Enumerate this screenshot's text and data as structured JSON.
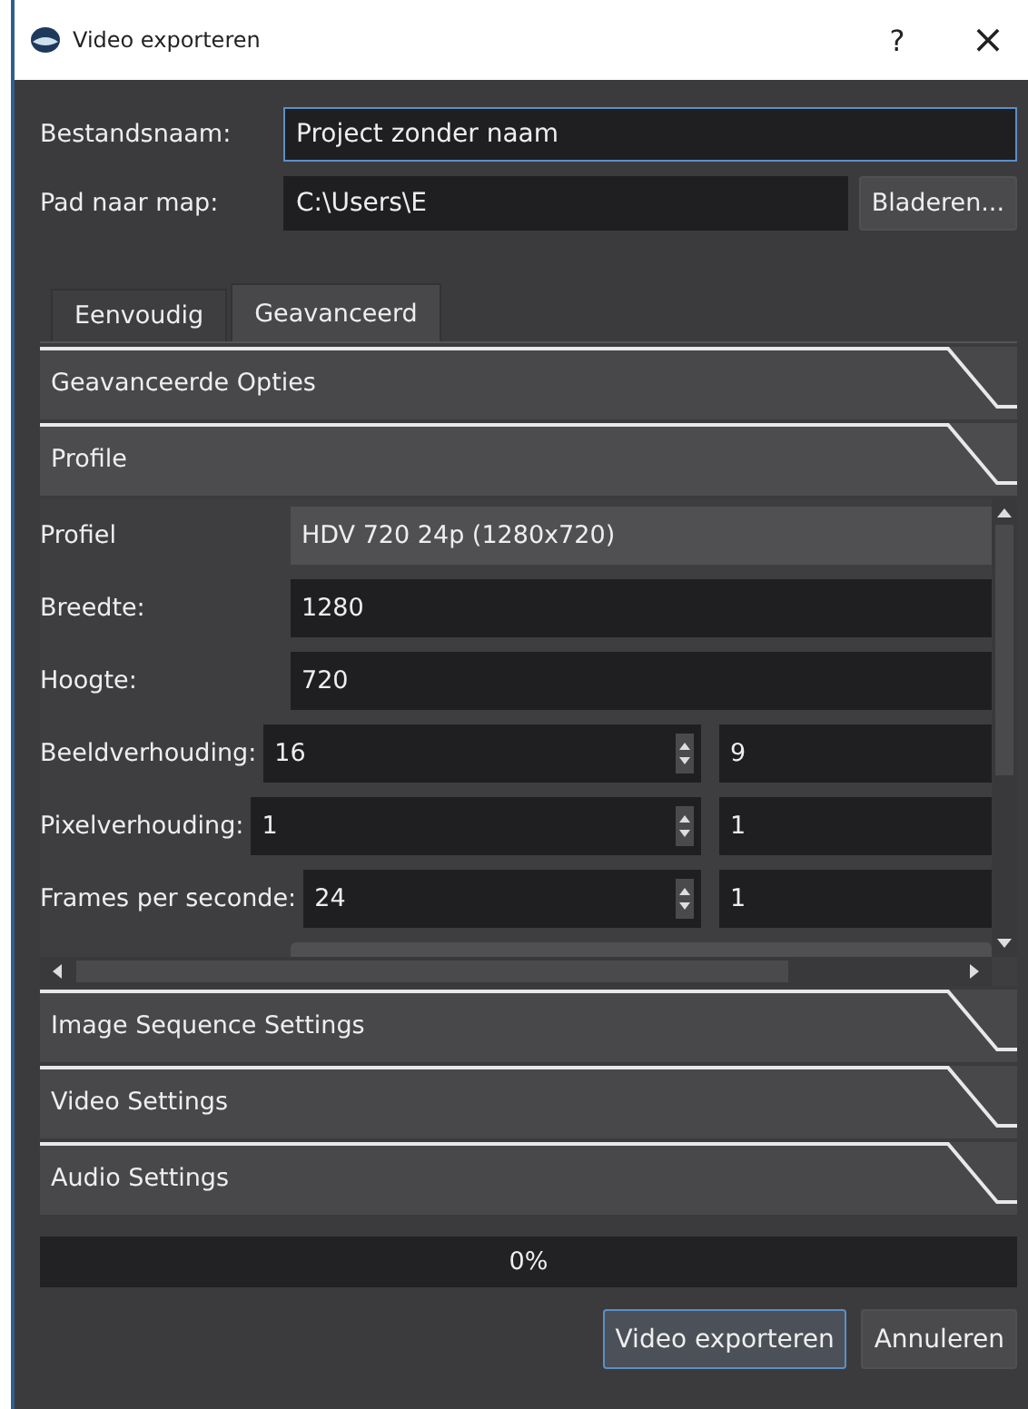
{
  "window": {
    "title": "Video exporteren",
    "help": "?",
    "close": "×"
  },
  "file_name": {
    "label": "Bestandsnaam:",
    "value": "Project zonder naam"
  },
  "folder_path": {
    "label": "Pad naar map:",
    "value": "C:\\Users\\E",
    "button": "Bladeren..."
  },
  "tabs": [
    {
      "label": "Eenvoudig",
      "selected": false
    },
    {
      "label": "Geavanceerd",
      "selected": true
    }
  ],
  "sections": [
    {
      "title": "Geavanceerde Opties"
    },
    {
      "title": "Profile",
      "fields": [
        {
          "kind": "dropdown",
          "label": "Profiel",
          "value": "HDV 720 24p (1280x720)"
        },
        {
          "kind": "text",
          "label": "Breedte:",
          "value": "1280"
        },
        {
          "kind": "text",
          "label": "Hoogte:",
          "value": "720"
        },
        {
          "kind": "spin-pair",
          "label": "Beeldverhouding:",
          "value": "16",
          "value_2": "9"
        },
        {
          "kind": "spin-pair",
          "label": "Pixelverhouding:",
          "value": "1",
          "value_2": "1"
        },
        {
          "kind": "spin-pair",
          "label": "Frames per seconde:",
          "value": "24",
          "value_2": "1"
        },
        {
          "kind": "cut-dropdown"
        }
      ]
    },
    {
      "title": "Image Sequence Settings"
    },
    {
      "title": "Video Settings"
    },
    {
      "title": "Audio Settings"
    }
  ],
  "progress": {
    "level": 0,
    "reading": "0%"
  },
  "buttons": [
    {
      "label": "Video exporteren",
      "default": true
    },
    {
      "label": "Annuleren",
      "default": false
    }
  ]
}
